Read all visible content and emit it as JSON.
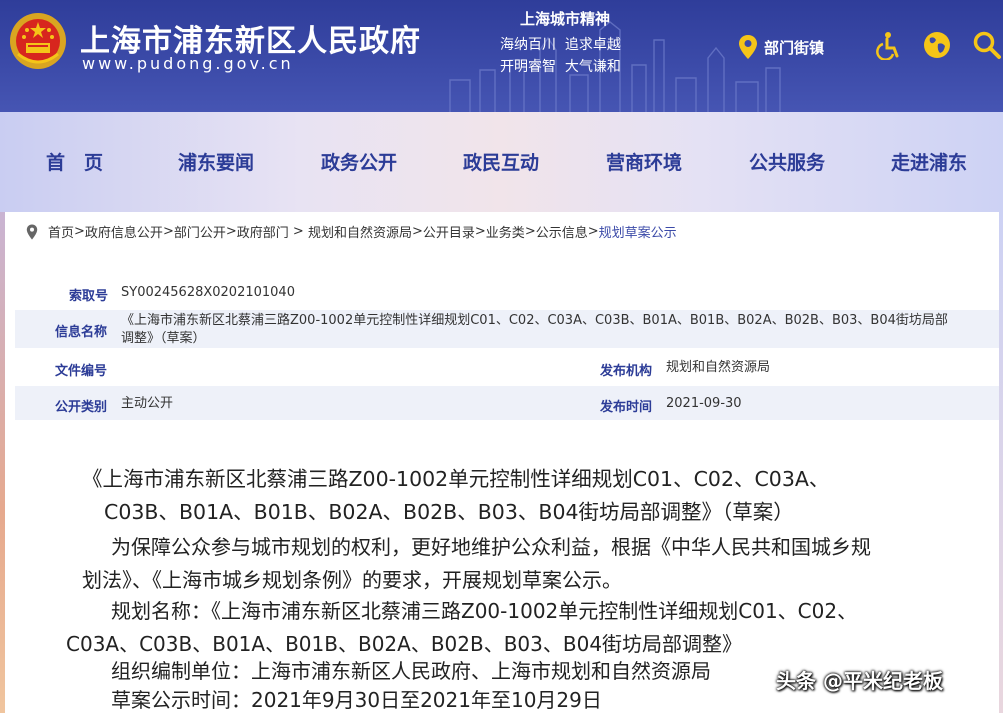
{
  "header": {
    "site_title": "上海市浦东新区人民政府",
    "site_url": "www.pudong.gov.cn",
    "spirit_title": "上海城市精神",
    "spirit_line1": "海纳百川  追求卓越",
    "spirit_line2": "开明睿智  大气谦和",
    "dept_label": "部门街镇",
    "icons": [
      "location-pin-icon",
      "accessibility-icon",
      "globe-icon",
      "search-icon"
    ],
    "bg_color": "#3b4aa8"
  },
  "nav": {
    "items": [
      "首　页",
      "浦东要闻",
      "政务公开",
      "政民互动",
      "营商环境",
      "公共服务",
      "走进浦东"
    ],
    "text_color": "#2c3c97"
  },
  "breadcrumb": {
    "items": [
      "首页",
      "政府信息公开",
      "部门公开",
      "政府部门",
      "规划和自然资源局",
      "公开目录",
      "业务类",
      "公示信息",
      "规划草案公示"
    ],
    "separators": [
      ">",
      ">",
      ">",
      " > ",
      ">",
      ">",
      ">",
      ">"
    ]
  },
  "meta": {
    "index_label": "索取号",
    "index_value": "SY00245628X0202101040",
    "name_label": "信息名称",
    "name_value_line1": "《上海市浦东新区北蔡浦三路Z00-1002单元控制性详细规划C01、C02、C03A、C03B、B01A、B01B、B02A、B02B、B03、B04街坊局部",
    "name_value_line2": "调整》（草案）",
    "docno_label": "文件编号",
    "docno_value": "",
    "publisher_label": "发布机构",
    "publisher_value": "规划和自然资源局",
    "category_label": "公开类别",
    "category_value": "主动公开",
    "date_label": "发布时间",
    "date_value": "2021-09-30"
  },
  "article": {
    "title_line1": "《上海市浦东新区北蔡浦三路Z00-1002单元控制性详细规划C01、C02、C03A、",
    "title_line2": "C03B、B01A、B01B、B02A、B02B、B03、B04街坊局部调整》（草案）",
    "p1_line1": "为保障公众参与城市规划的权利，更好地维护公众利益，根据《中华人民共和国城乡规",
    "p1_line2": "划法》、《上海市城乡规划条例》的要求，开展规划草案公示。",
    "p2_line1": "规划名称：《上海市浦东新区北蔡浦三路Z00-1002单元控制性详细规划C01、C02、",
    "p2_line2": "C03A、C03B、B01A、B01B、B02A、B02B、B03、B04街坊局部调整》",
    "p3": "组织编制单位：上海市浦东新区人民政府、上海市规划和自然资源局",
    "p4": "草案公示时间：2021年9月30日至2021年至10月29日"
  },
  "watermark": "头条 @平米纪老板"
}
